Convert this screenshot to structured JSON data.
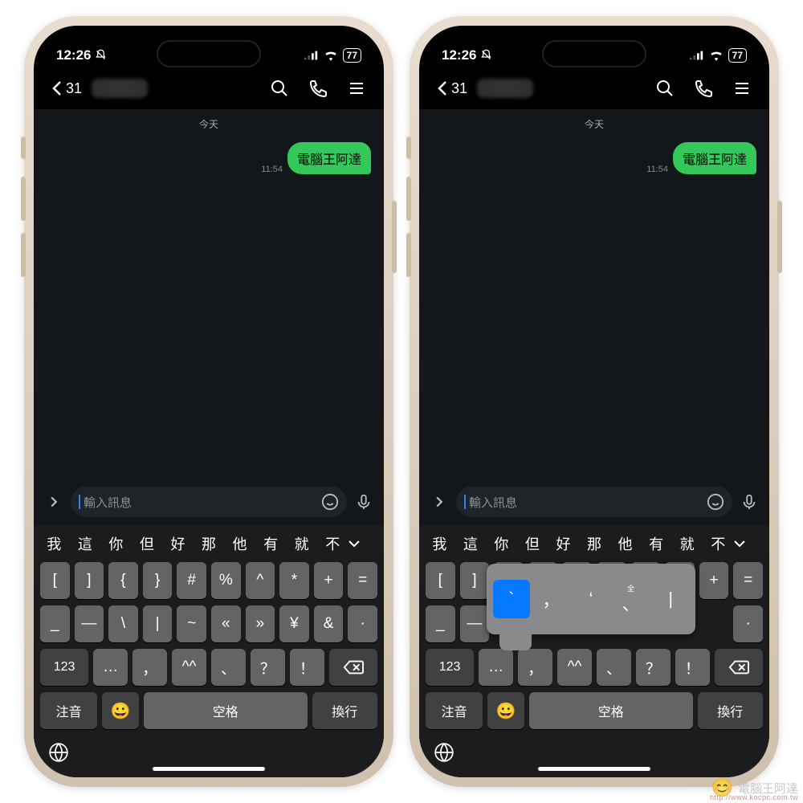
{
  "status": {
    "time": "12:26",
    "battery": "77"
  },
  "header": {
    "back_count": "31"
  },
  "chat": {
    "day_separator": "今天",
    "message": {
      "text": "電腦王阿達",
      "time": "11:54"
    }
  },
  "input": {
    "placeholder": "輸入訊息"
  },
  "candidates": [
    "我",
    "這",
    "你",
    "但",
    "好",
    "那",
    "他",
    "有",
    "就",
    "不"
  ],
  "rows": {
    "r1": [
      "[",
      "]",
      "{",
      "}",
      "#",
      "%",
      "^",
      "*",
      "+",
      "="
    ],
    "r2": [
      "_",
      "—",
      "\\",
      "|",
      "~",
      "«",
      "»",
      "¥",
      "&",
      "·"
    ],
    "r3_left": "123",
    "r3_keys": [
      "…",
      "，",
      "^^",
      "、",
      "？",
      "！"
    ],
    "r4_left": "注音",
    "space": "空格",
    "ret": "換行"
  },
  "popup": {
    "items": [
      {
        "label": "`",
        "tag": ""
      },
      {
        "label": "，",
        "tag": ""
      },
      {
        "label": "‘",
        "tag": ""
      },
      {
        "label": "、",
        "tag": "全"
      },
      {
        "label": "|",
        "tag": ""
      }
    ],
    "selected": 0
  },
  "watermark": {
    "brand": "電腦王阿達",
    "url": "http://www.kocpc.com.tw"
  }
}
